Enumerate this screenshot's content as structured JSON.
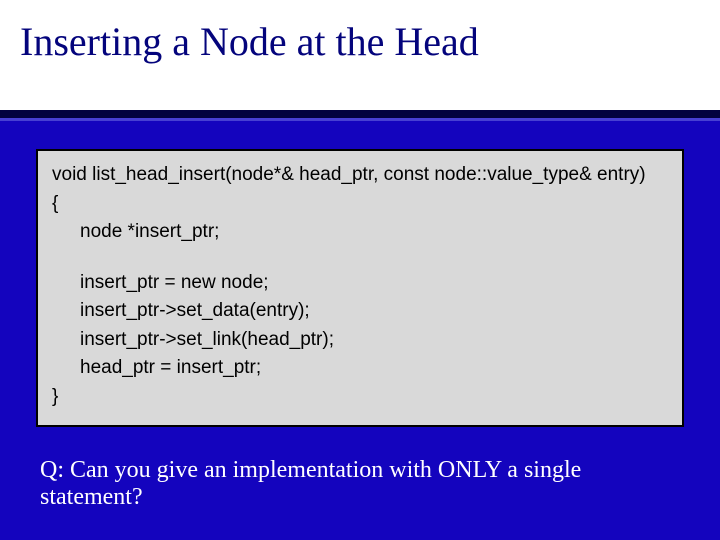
{
  "title": "Inserting a Node at the Head",
  "code": {
    "sig": "void list_head_insert(node*& head_ptr, const node::value_type& entry)",
    "openBrace": "{",
    "decl": "node *insert_ptr;",
    "l1": "insert_ptr = new node;",
    "l2": "insert_ptr->set_data(entry);",
    "l3": "insert_ptr->set_link(head_ptr);",
    "l4": "head_ptr = insert_ptr;",
    "closeBrace": "}"
  },
  "question": "Q: Can you give an implementation with ONLY a single statement?"
}
